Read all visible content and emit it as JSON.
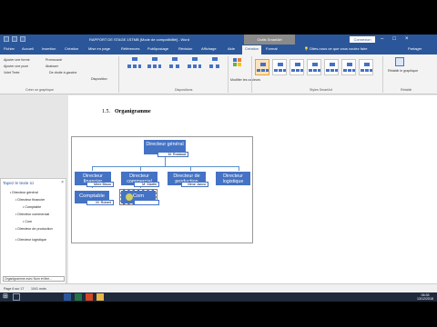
{
  "colors": {
    "word_blue": "#2b579a",
    "smartart_blue": "#4472c4",
    "taskbar": "#1f2a3c"
  },
  "window": {
    "title": "RAPPORT DE STAGE 1STMB [Mode de compatibilité] - Word",
    "context_tab": "Outils SmartArt",
    "connect_button": "Connexion"
  },
  "tabs": {
    "fichier": "Fichier",
    "accueil": "Accueil",
    "insertion": "Insertion",
    "creation": "Création",
    "mise_en_page": "Mise en page",
    "references": "Références",
    "publipostage": "Publipostage",
    "revision": "Révision",
    "affichage": "Affichage",
    "aide": "Aide",
    "creation_smartart": "Création",
    "format": "Format",
    "tell_me": "Dites-nous ce que vous voulez faire",
    "share": "Partager"
  },
  "ribbon": {
    "add_shape": "Ajouter une forme",
    "add_bullet": "Ajouter une puce",
    "text_pane": "Volet Texte",
    "promote": "Promouvoir",
    "demote": "Abaisser",
    "right_to_left": "De droite à gauche",
    "layout_btn": "Disposition",
    "group_create": "Créer un graphique",
    "group_layouts": "Dispositions",
    "change_colors": "Modifier les couleurs",
    "group_styles": "Styles SmartArt",
    "reset": "Rétablir le graphique",
    "group_reset": "Rétablir"
  },
  "document": {
    "heading_number": "1.5.",
    "heading_text": "Organigramme"
  },
  "orgchart": {
    "director": "Directeur général",
    "director_name": "M. Rostaud",
    "finance": "Directeur financier",
    "finance_name": "Mme Bisou",
    "commercial": "Directeur commercial",
    "commercial_name": "M. Martin",
    "production": "Directeur de production",
    "production_name": "Mme Janvo",
    "logistics": "Directeur logistique",
    "comptable": "Comptable",
    "comptable_name": "M. Robert",
    "com": "Com"
  },
  "text_pane": {
    "title": "Tapez le texte ici",
    "items": [
      "Directeur général",
      "Directeur financier",
      "Comptable",
      "Directeur commercial",
      "Com",
      "Directeur de production",
      "Directeur logistique"
    ],
    "footer": "Organigramme avec Nom et titre..."
  },
  "status": {
    "page": "Page 6 sur 17",
    "words": "1041 mots",
    "time": "08:35",
    "date": "13/12/2018"
  }
}
